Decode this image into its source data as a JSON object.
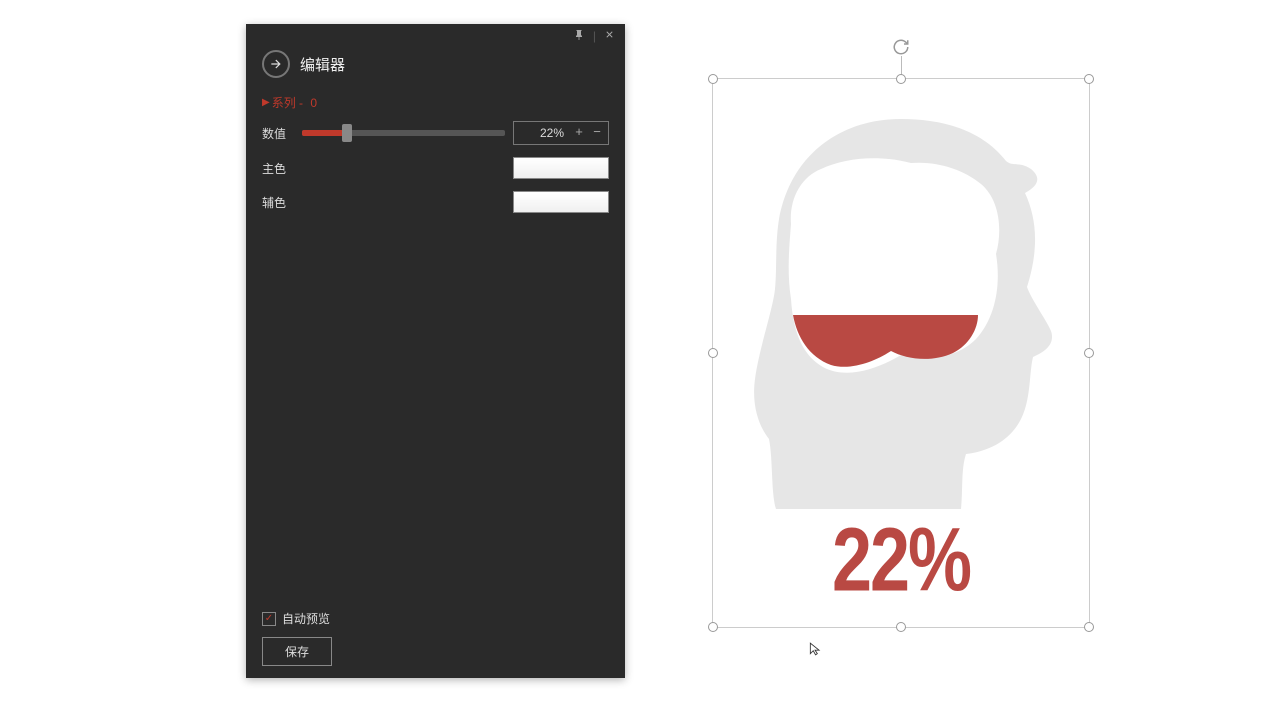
{
  "panel": {
    "title": "编辑器",
    "series_prefix": "系列 -",
    "series_index": "0",
    "controls": {
      "value_label": "数值",
      "value_text": "22%",
      "value_percent": 22,
      "main_color_label": "主色",
      "aux_color_label": "辅色",
      "main_color": "#ffffff",
      "aux_color": "#ffffff"
    },
    "footer": {
      "auto_preview_label": "自动预览",
      "auto_preview_checked": true,
      "save_label": "保存"
    }
  },
  "chart_data": {
    "type": "pictograph-fill",
    "subject": "human-head-brain",
    "fill_percent": 22,
    "series": [
      {
        "name": "系列 - 0",
        "value": 22
      }
    ],
    "display_label": "22%",
    "fill_color": "#b94943",
    "background_shape_color": "#e6e6e6",
    "container_color": "#ffffff"
  }
}
